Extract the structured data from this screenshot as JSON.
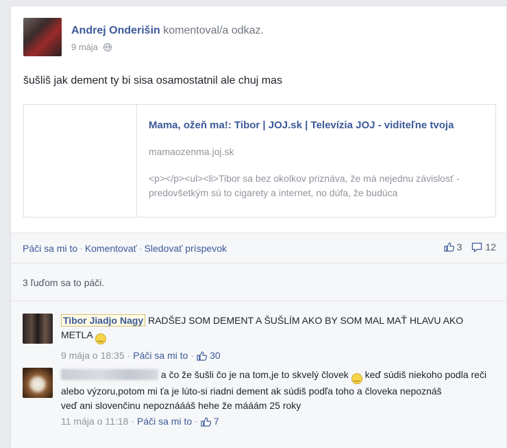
{
  "post": {
    "author": "Andrej Onderišin",
    "action": "komentoval/a odkaz.",
    "date": "9 mája",
    "status_text": "šušliš jak dement ty bi sisa osamostatnil ale chuj mas",
    "audience_icon": "globe-icon"
  },
  "link_preview": {
    "title": "Mama, ožeň ma!: Tibor | JOJ.sk | Televízia JOJ - viditeľne tvoja",
    "domain": "mamaozenma.joj.sk",
    "description": "<p></p><ul><li>Tibor sa bez okolkov priznáva, že má nejednu závislosť - predovšetkým sú to cigarety a internet, no dúfa, že budúca"
  },
  "actions": {
    "like": "Páči sa mi to",
    "comment": "Komentovať",
    "follow": "Sledovať príspevok",
    "like_count": "3",
    "comment_count": "12"
  },
  "likes_summary": "3 ľuďom sa to páči.",
  "comments": [
    {
      "author": "Tibor Jiadjo Nagy",
      "text_part1": "RADŠEJ SOM DEMENT A ŠUŠLÍM AKO BY SOM MAL MAŤ HLAVU AKO METLA",
      "date": "9 mája o 18:35",
      "like_label": "Páči sa mi to",
      "likes": "30"
    },
    {
      "author": "",
      "text_part1": "a čo že šušli čo je na tom,je to skvelý človek",
      "text_part2": "keď súdiš niekoho podla reči alebo výzoru,potom mi ťa je lúto-si riadni dement ak súdiš podľa toho a človeka nepoznáš",
      "text_part3": "veď ani slovenčinu nepoznáááš hehe že mááám 25 roky",
      "date": "11 mája o 11:18",
      "like_label": "Páči sa mi to",
      "likes": "7"
    }
  ],
  "colors": {
    "link_blue": "#3b5998",
    "muted": "#90949c",
    "background": "#e9eaed"
  }
}
